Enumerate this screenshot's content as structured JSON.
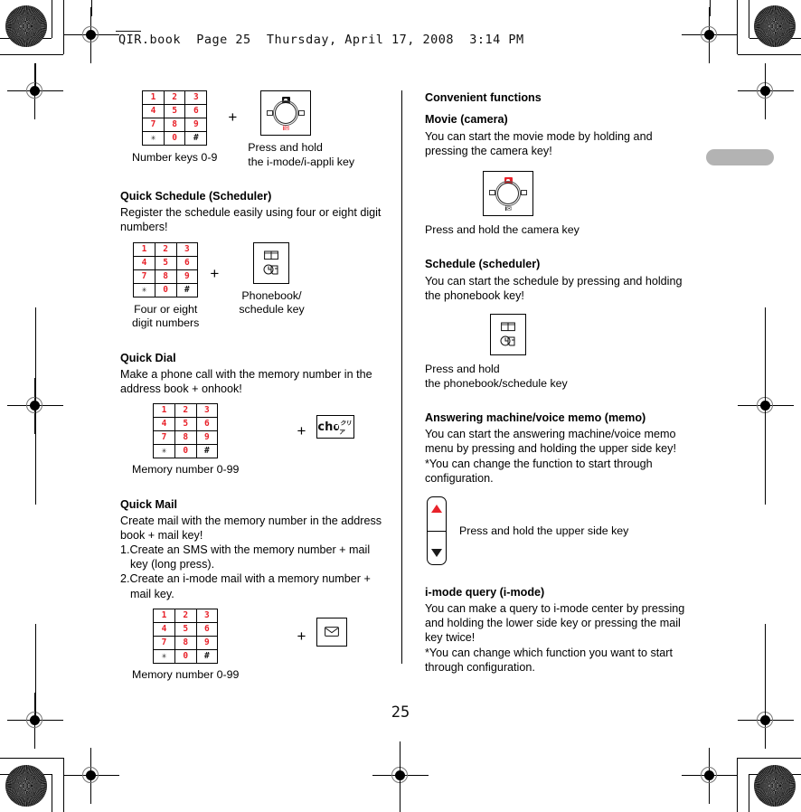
{
  "page": {
    "header": "QIR.book  Page 25  Thursday, April 17, 2008  3:14 PM",
    "page_number": "25"
  },
  "left_column": {
    "top_figure": {
      "keypad_caption": "Number keys 0-9",
      "plus": "+",
      "navkey_caption_line1": "Press and hold",
      "navkey_caption_line2": "the i-mode/i-appli key",
      "navkey_label": "i✉"
    },
    "sections": [
      {
        "heading": "Quick Schedule (Scheduler)",
        "body_line1": "Register the schedule easily using four or eight digit",
        "body_line2": "numbers!",
        "plus": "+",
        "left_caption_line1": "Four or eight",
        "left_caption_line2": "digit numbers",
        "right_caption_line1": "Phonebook/",
        "right_caption_line2": "schedule key"
      },
      {
        "heading": "Quick Dial",
        "body_line1": "Make a phone call with the memory number in the",
        "body_line2": "address book + onhook!",
        "plus": "+",
        "caption": "Memory number 0-99",
        "clear_key_text": "ch",
        "clear_key_kana": "クリア"
      },
      {
        "heading": "Quick Mail",
        "body_line1": "Create mail with the memory number in the address",
        "body_line2": "book + mail key!",
        "list_item1_line1": "1.Create an SMS with the memory number + mail",
        "list_item1_line2": "key (long press).",
        "list_item2_line1": "2.Create an i-mode mail with a memory number +",
        "list_item2_line2": "mail key.",
        "plus": "+",
        "caption": "Memory number 0-99"
      }
    ],
    "keypad_rows": [
      [
        "1",
        "2",
        "3"
      ],
      [
        "4",
        "5",
        "6"
      ],
      [
        "7",
        "8",
        "9"
      ],
      [
        "✳",
        "0",
        "#"
      ]
    ]
  },
  "right_column": {
    "heading": "Convenient functions",
    "sections": [
      {
        "heading": "Movie (camera)",
        "body_line1": "You can start the movie mode by holding and",
        "body_line2": "pressing the camera key!",
        "caption": "Press and hold the camera key",
        "navkey_label": "i✉"
      },
      {
        "heading": "Schedule (scheduler)",
        "body_line1": "You can start the schedule by pressing and holding",
        "body_line2": "the phonebook key!",
        "caption_line1": "Press and hold",
        "caption_line2": "the phonebook/schedule key"
      },
      {
        "heading": "Answering machine/voice memo (memo)",
        "body_line1": "You can start the answering machine/voice memo",
        "body_line2": "menu by pressing and holding the upper side key!",
        "body_line3": "*You can change the function to start through",
        "body_line4": "configuration.",
        "caption": "Press and hold the upper side key"
      },
      {
        "heading": "i-mode query (i-mode)",
        "body_line1": "You can make a query to i-mode center by pressing",
        "body_line2": "and holding the lower side key or pressing the mail",
        "body_line3": "key twice!",
        "body_line4": "*You can change which function you want to start",
        "body_line5": "through configuration."
      }
    ]
  },
  "colors": {
    "accent_red": "#e8222a",
    "text": "#000000",
    "tab_marker": "#b3b3b3"
  }
}
